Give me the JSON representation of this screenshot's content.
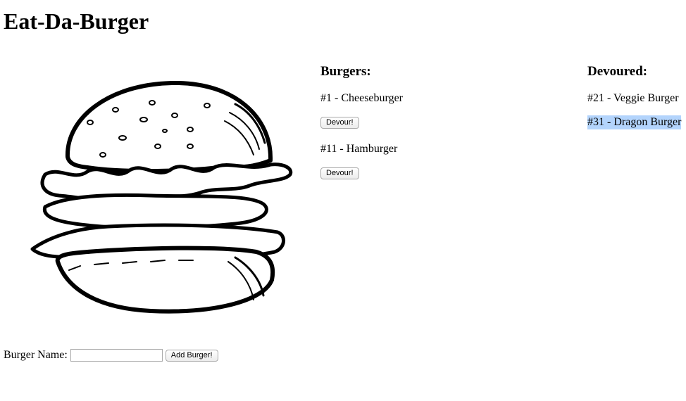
{
  "page": {
    "title": "Eat-Da-Burger"
  },
  "hero_image": {
    "icon": "burger-illustration"
  },
  "burgers": {
    "heading": "Burgers:",
    "items": [
      {
        "label": "#1 - Cheeseburger",
        "button": "Devour!"
      },
      {
        "label": "#11 - Hamburger",
        "button": "Devour!"
      }
    ]
  },
  "devoured": {
    "heading": "Devoured:",
    "items": [
      {
        "label": "#21 - Veggie Burger"
      },
      {
        "label": "#31 - Dragon Burger",
        "selected": true
      }
    ]
  },
  "form": {
    "label": "Burger Name:",
    "input_value": "",
    "submit_label": "Add Burger!"
  },
  "colors": {
    "selection": "#b3d4fc"
  }
}
